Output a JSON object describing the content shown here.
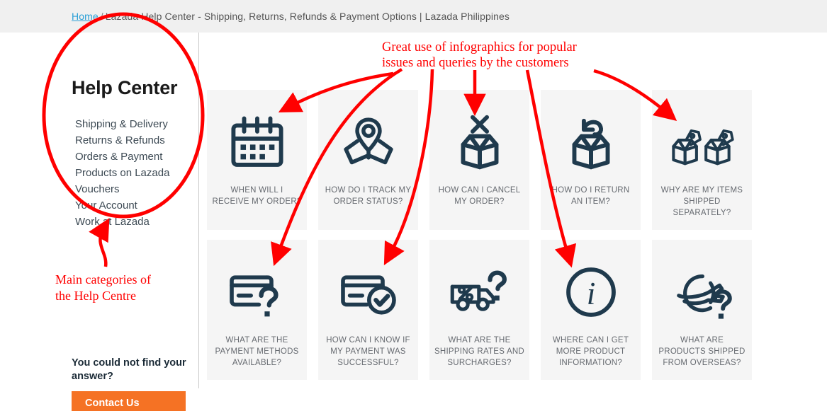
{
  "breadcrumb": {
    "home_label": "Home",
    "separator": "/",
    "current": "Lazada Help Center - Shipping, Returns, Refunds & Payment Options | Lazada Philippines"
  },
  "sidebar": {
    "title": "Help Center",
    "items": [
      {
        "label": "Shipping & Delivery"
      },
      {
        "label": "Returns & Refunds"
      },
      {
        "label": "Orders & Payment"
      },
      {
        "label": "Products on Lazada"
      },
      {
        "label": "Vouchers"
      },
      {
        "label": "Your Account"
      },
      {
        "label": "Work at Lazada"
      }
    ],
    "find_answer_text": "You could not find your answer?",
    "contact_button_label": "Contact Us"
  },
  "cards": [
    {
      "icon": "calendar-icon",
      "label": "WHEN WILL I RECEIVE MY ORDER?"
    },
    {
      "icon": "map-pin-icon",
      "label": "HOW DO I TRACK MY ORDER STATUS?"
    },
    {
      "icon": "box-cancel-icon",
      "label": "HOW CAN I CANCEL MY ORDER?"
    },
    {
      "icon": "box-return-icon",
      "label": "HOW DO I RETURN AN ITEM?"
    },
    {
      "icon": "two-boxes-tag-icon",
      "label": "WHY ARE MY ITEMS SHIPPED SEPARATELY?"
    },
    {
      "icon": "card-question-icon",
      "label": "WHAT ARE THE PAYMENT METHODS AVAILABLE?"
    },
    {
      "icon": "card-check-icon",
      "label": "HOW CAN I KNOW IF MY PAYMENT WAS SUCCESSFUL?"
    },
    {
      "icon": "truck-percent-question-icon",
      "label": "WHAT ARE THE SHIPPING RATES AND SURCHARGES?"
    },
    {
      "icon": "info-circle-icon",
      "label": "WHERE CAN I GET MORE PRODUCT INFORMATION?"
    },
    {
      "icon": "globe-plane-question-icon",
      "label": "WHAT ARE PRODUCTS SHIPPED FROM OVERSEAS?"
    }
  ],
  "annotations": {
    "top_line1": "Great use of infographics for popular",
    "top_line2": "issues and queries by the customers",
    "left_line1": "Main categories of",
    "left_line2": "the Help Centre"
  },
  "colors": {
    "annotation_red": "#ff0000",
    "brand_orange": "#f57224",
    "icon_navy": "#1f3a4d",
    "card_background": "#f5f5f5",
    "breadcrumb_bar": "#f0f0f0",
    "link_blue": "#2a9fd6"
  }
}
